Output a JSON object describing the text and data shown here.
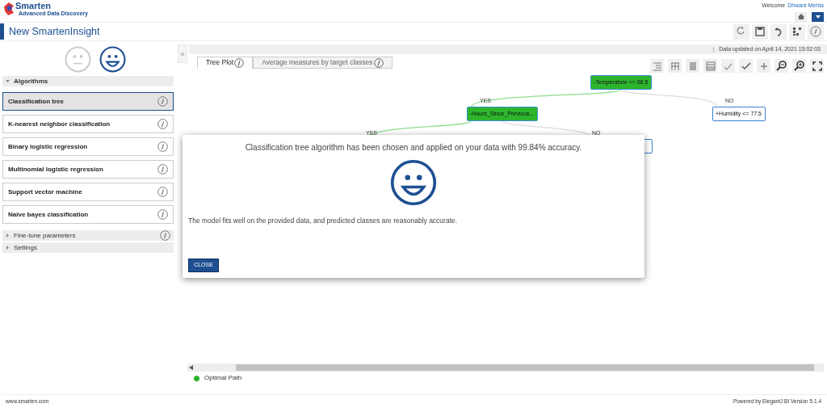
{
  "header": {
    "logo_title": "Smarten",
    "logo_subtitle": "Advanced Data Discovery",
    "welcome": "Welcome",
    "user": "Dhwani Mehta"
  },
  "page_title": "New SmartenInsight",
  "faces": [
    {
      "kind": "neutral",
      "selected": false
    },
    {
      "kind": "happy",
      "selected": true
    }
  ],
  "sidebar": {
    "sections": [
      {
        "title": "Algorithms",
        "expanded": true,
        "info": false
      },
      {
        "title": "Fine-tune parameters",
        "expanded": false,
        "info": true
      },
      {
        "title": "Settings",
        "expanded": false,
        "info": false
      }
    ],
    "algorithms": [
      {
        "label": "Classification tree",
        "selected": true
      },
      {
        "label": "K-nearest neighbor classification",
        "selected": false
      },
      {
        "label": "Binary logistic regression",
        "selected": false
      },
      {
        "label": "Multinomial logistic regression",
        "selected": false
      },
      {
        "label": "Support vector machine",
        "selected": false
      },
      {
        "label": "Naive bayes classification",
        "selected": false
      }
    ]
  },
  "collapse_button": "«",
  "separator": "|",
  "data_updated": "Data updated on April 14, 2021 15:02:03",
  "tabs": [
    {
      "label": "Tree Plot",
      "selected": true
    },
    {
      "label": "Average measures by target classes",
      "selected": false
    }
  ],
  "tree": {
    "nodes": [
      {
        "text": "-Temperature <= 68.5",
        "on_path": true
      },
      {
        "text": "-Hours_Since_Previous...",
        "on_path": true
      },
      {
        "text": "+Humidity <= 77.5",
        "on_path": false
      }
    ],
    "edges": [
      {
        "label": "YES",
        "on_path": true
      },
      {
        "label": "NO",
        "on_path": false
      },
      {
        "label": "YES",
        "on_path": true
      },
      {
        "label": "NO",
        "on_path": false
      }
    ]
  },
  "legend": {
    "label": "Optimal Path",
    "color": "#2db52d"
  },
  "modal": {
    "message": "Classification tree algorithm has been chosen and applied on your data with 99.84% accuracy.",
    "detail": "The model fits well on the provided data, and predicted classes are reasonably accurate.",
    "button": "CLOSE"
  },
  "footer": {
    "left": "www.smarten.com",
    "right": "Powered by ElegantJ BI Version 5.1.4"
  }
}
